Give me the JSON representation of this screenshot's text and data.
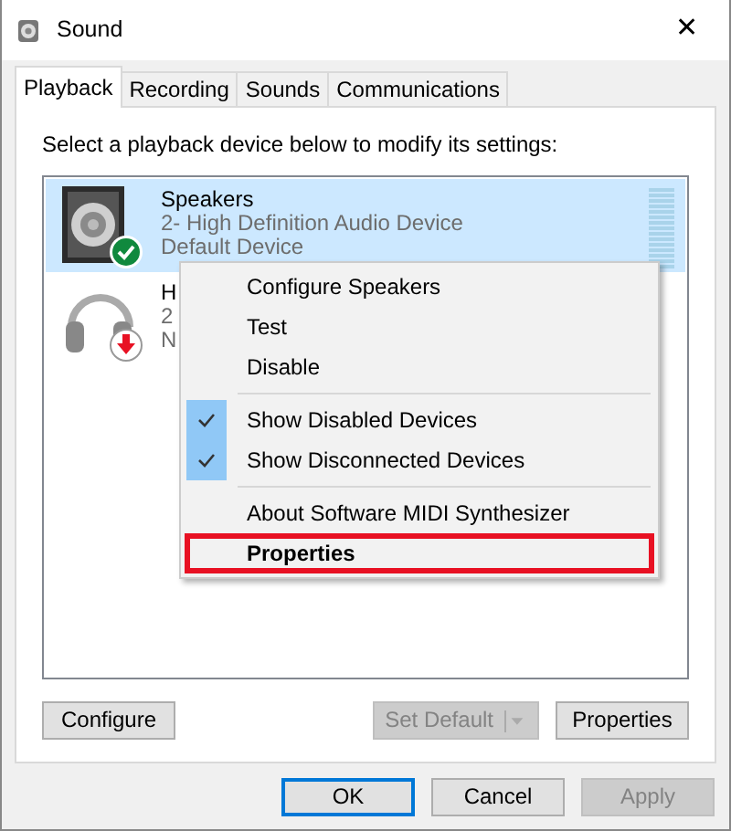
{
  "window": {
    "title": "Sound",
    "close": "✕"
  },
  "tabs": [
    {
      "label": "Playback",
      "selected": true
    },
    {
      "label": "Recording",
      "selected": false
    },
    {
      "label": "Sounds",
      "selected": false
    },
    {
      "label": "Communications",
      "selected": false
    }
  ],
  "instruction": "Select a playback device below to modify its settings:",
  "devices": [
    {
      "kind": "speaker",
      "selected": true,
      "name": "Speakers",
      "driver": "2- High Definition Audio Device",
      "status": "Default Device",
      "is_default": true,
      "unplugged": false,
      "meter": {
        "level": 0
      }
    },
    {
      "kind": "headphones",
      "selected": false,
      "name": "H",
      "driver": "2",
      "status": "N",
      "is_default": false,
      "unplugged": true
    }
  ],
  "context_menu": [
    {
      "kind": "item",
      "label": "Configure Speakers",
      "checked": false,
      "bold": false,
      "outlined": false
    },
    {
      "kind": "item",
      "label": "Test",
      "checked": false,
      "bold": false,
      "outlined": false
    },
    {
      "kind": "item",
      "label": "Disable",
      "checked": false,
      "bold": false,
      "outlined": false
    },
    {
      "kind": "separator"
    },
    {
      "kind": "item",
      "label": "Show Disabled Devices",
      "checked": true,
      "bold": false,
      "outlined": false
    },
    {
      "kind": "item",
      "label": "Show Disconnected Devices",
      "checked": true,
      "bold": false,
      "outlined": false
    },
    {
      "kind": "separator"
    },
    {
      "kind": "item",
      "label": "About Software MIDI Synthesizer",
      "checked": false,
      "bold": false,
      "outlined": false
    },
    {
      "kind": "item",
      "label": "Properties",
      "checked": false,
      "bold": true,
      "outlined": true
    }
  ],
  "panel_buttons": [
    {
      "label": "Configure",
      "disabled": false,
      "split": false
    },
    {
      "label": "Set Default",
      "disabled": true,
      "split": true
    },
    {
      "label": "Properties",
      "disabled": false,
      "split": false
    }
  ],
  "dialog_buttons": [
    {
      "label": "OK",
      "disabled": false,
      "focused": true
    },
    {
      "label": "Cancel",
      "disabled": false,
      "focused": false
    },
    {
      "label": "Apply",
      "disabled": true,
      "focused": false
    }
  ]
}
